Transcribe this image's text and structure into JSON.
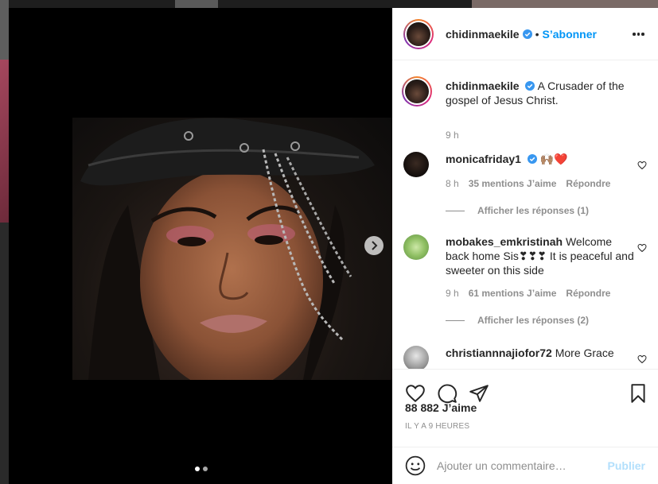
{
  "post": {
    "username": "chidinmaekile",
    "separator": "•",
    "subscribe_label": "S’abonner",
    "caption": "A Crusader of the gospel of Jesus Christ.",
    "caption_time": "9 h",
    "likes": "88 882 J’aime",
    "posted_ago": "IL Y A 9 HEURES",
    "carousel_count": 2,
    "carousel_index": 1
  },
  "comments": [
    {
      "username": "monicafriday1",
      "text": "🙌🏽❤️",
      "time": "8 h",
      "likes": "35 mentions J’aime",
      "reply": "Répondre",
      "view_replies": "Afficher les réponses (1)"
    },
    {
      "username": "mobakes_emkristinah",
      "text": "Welcome back home Sis❣❣❣ It is peaceful and sweeter on this side",
      "time": "9 h",
      "likes": "61 mentions J’aime",
      "reply": "Répondre",
      "view_replies": "Afficher les réponses (2)"
    },
    {
      "username": "christiannnajiofor72",
      "text": "More Grace"
    }
  ],
  "composer": {
    "placeholder": "Ajouter un commentaire…",
    "publish_label": "Publier"
  },
  "colors": {
    "accent": "#0095f6",
    "muted": "#8e8e8e",
    "verified": "#3897f0"
  },
  "icons": [
    "more-options-icon",
    "verified-badge-icon",
    "heart-icon",
    "comment-icon",
    "share-icon",
    "bookmark-icon",
    "emoji-icon",
    "chevron-right-icon"
  ]
}
